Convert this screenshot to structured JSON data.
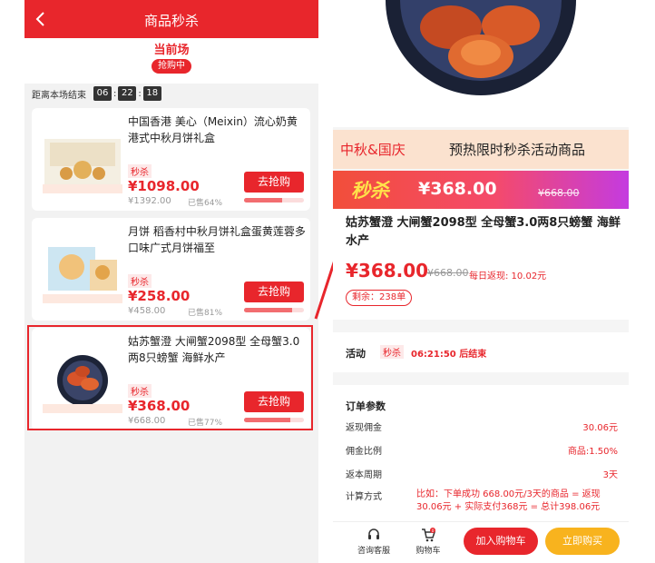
{
  "left": {
    "title": "商品秒杀",
    "session_name": "当前场",
    "session_status": "抢购中",
    "countdown_label": "距离本场结束",
    "countdown": {
      "h": "06",
      "m": "22",
      "s": "18"
    },
    "products": [
      {
        "title": "中国香港 美心（Meixin）流心奶黄 港式中秋月饼礼盒",
        "tag": "秒杀",
        "price": "¥1098.00",
        "orig": "¥1392.00",
        "sold": "已售64%",
        "sold_pct": 0.64,
        "button": "去抢购"
      },
      {
        "title": "月饼 稻香村中秋月饼礼盒蛋黄莲蓉多口味广式月饼福至",
        "tag": "秒杀",
        "price": "¥258.00",
        "orig": "¥458.00",
        "sold": "已售81%",
        "sold_pct": 0.81,
        "button": "去抢购"
      },
      {
        "title": "姑苏蟹澄 大闸蟹2098型 全母蟹3.0两8只螃蟹 海鲜水产",
        "tag": "秒杀",
        "price": "¥368.00",
        "orig": "¥668.00",
        "sold": "已售77%",
        "sold_pct": 0.77,
        "button": "去抢购"
      }
    ]
  },
  "right": {
    "banner_left": "中秋&国庆",
    "banner_right": "预热限时秒杀活动商品",
    "promo_mark": "秒杀",
    "promo_price": "¥368.00",
    "promo_orig": "¥668.00",
    "product_title": "姑苏蟹澄 大闸蟹2098型 全母蟹3.0两8只螃蟹 海鲜水产",
    "price": "¥368.00",
    "orig_price": "¥668.00",
    "rebate": "每日返现: 10.02元",
    "remaining": "剩余：238单",
    "activity_label": "活动",
    "activity_tag": "秒杀",
    "activity_countdown": "06:21:50 后结束",
    "params_title": "订单参数",
    "params": [
      {
        "label": "返现佣金",
        "value": "30.06元"
      },
      {
        "label": "佣金比例",
        "value": "商品:1.50%"
      },
      {
        "label": "返本周期",
        "value": "3天"
      },
      {
        "label": "计算方式",
        "value": "比如：下单成功 668.00元/3天的商品 = 返现30.06元 + 实际支付368元 = 总计398.06元"
      }
    ],
    "bottom": {
      "service": "咨询客服",
      "cart": "购物车",
      "cart_count": "0",
      "add_cart": "加入购物车",
      "buy_now": "立即购买"
    }
  }
}
